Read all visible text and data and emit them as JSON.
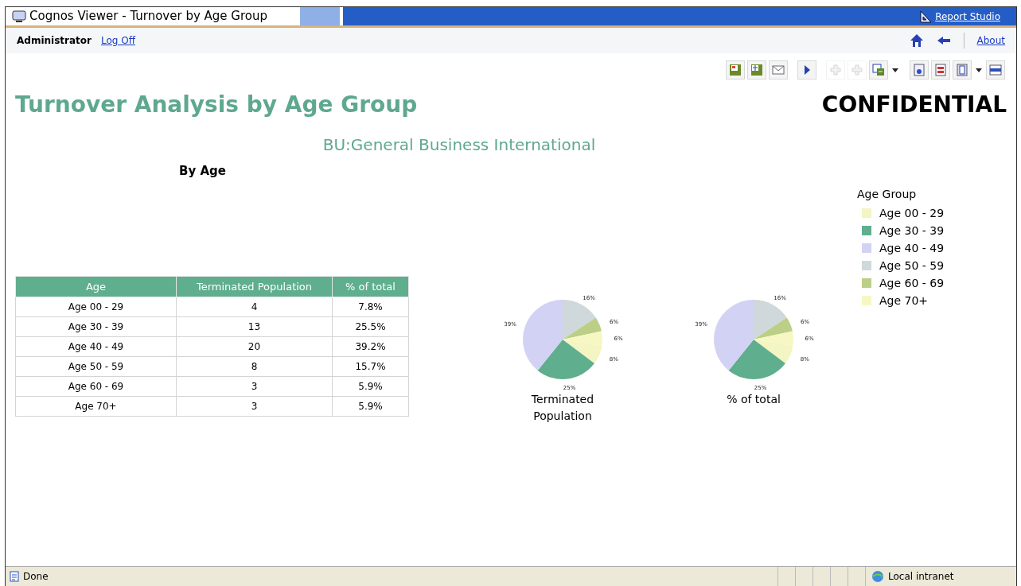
{
  "window": {
    "title": "Cognos Viewer - Turnover by Age Group",
    "studio_link": "Report Studio"
  },
  "user_bar": {
    "user": "Administrator",
    "logoff": "Log Off",
    "about": "About"
  },
  "toolbar": [
    {
      "kind": "save",
      "disabled": false,
      "has_menu": false
    },
    {
      "kind": "save-as",
      "disabled": false,
      "has_menu": false
    },
    {
      "kind": "email",
      "disabled": false,
      "has_menu": false
    },
    {
      "kind": "run",
      "disabled": false,
      "has_menu": false
    },
    {
      "kind": "drill-down",
      "disabled": true,
      "has_menu": false
    },
    {
      "kind": "drill-up",
      "disabled": true,
      "has_menu": false
    },
    {
      "kind": "go-to",
      "disabled": false,
      "has_menu": true
    },
    {
      "kind": "watch",
      "disabled": false,
      "has_menu": false
    },
    {
      "kind": "pdf",
      "disabled": false,
      "has_menu": false
    },
    {
      "kind": "view",
      "disabled": false,
      "has_menu": true
    },
    {
      "kind": "xml",
      "disabled": false,
      "has_menu": false
    }
  ],
  "report": {
    "title": "Turnover Analysis by Age Group",
    "stamp": "CONFIDENTIAL",
    "subtitle": "BU:General Business International",
    "section": "By Age"
  },
  "table": {
    "columns": [
      "Age",
      "Terminated Population",
      "% of total"
    ],
    "rows": [
      [
        "Age 00 - 29",
        "4",
        "7.8%"
      ],
      [
        "Age 30 - 39",
        "13",
        "25.5%"
      ],
      [
        "Age 40 - 49",
        "20",
        "39.2%"
      ],
      [
        "Age 50 - 59",
        "8",
        "15.7%"
      ],
      [
        "Age 60 - 69",
        "3",
        "5.9%"
      ],
      [
        "Age 70+",
        "3",
        "5.9%"
      ]
    ]
  },
  "charts": [
    {
      "chart_data": {
        "type": "pie",
        "title": "Terminated Population",
        "values": [
          7.8,
          25.5,
          39.2,
          15.7,
          5.9,
          5.9
        ],
        "value_labels": [
          "8%",
          "25%",
          "39%",
          "16%",
          "6%",
          "6%"
        ]
      }
    },
    {
      "chart_data": {
        "type": "pie",
        "title": "% of total",
        "values": [
          7.8,
          25.5,
          39.2,
          15.7,
          5.9,
          5.9
        ],
        "value_labels": [
          "8%",
          "25%",
          "39%",
          "16%",
          "6%",
          "6%"
        ]
      }
    }
  ],
  "legend": {
    "title": "Age Group",
    "items": [
      {
        "label": "Age 00 - 29",
        "color": "#f3f5c2"
      },
      {
        "label": "Age 30 - 39",
        "color": "#5fae8e"
      },
      {
        "label": "Age 40 - 49",
        "color": "#d2d2f5"
      },
      {
        "label": "Age 50 - 59",
        "color": "#cfd8da"
      },
      {
        "label": "Age 60 - 69",
        "color": "#bccf86"
      },
      {
        "label": "Age 70+",
        "color": "#f7f7c4"
      }
    ]
  },
  "status_bar": {
    "message": "Done",
    "zone": "Local intranet"
  }
}
